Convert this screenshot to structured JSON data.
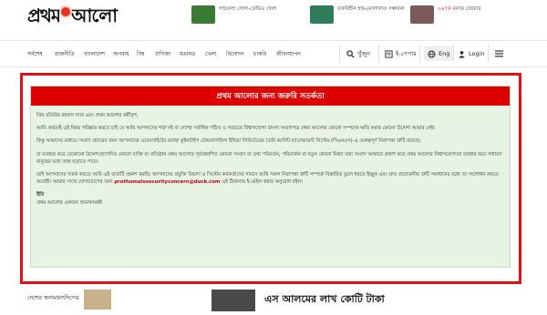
{
  "header": {
    "logo_text_before": "প্রথম",
    "logo_text_after": "আলো",
    "promos": [
      {
        "text": "গাছতলা লোল-ডেভিড খেলা",
        "highlight": "",
        "color": "#3a7a32"
      },
      {
        "text": "চাকরিহীন হার-মোলাকাত সম্ভাবনা",
        "highlight": "",
        "color": "#2f7d5a"
      },
      {
        "text": "বন্যার জোয়ার",
        "highlight": "০৬৭ফ",
        "color": "#7a5a5a"
      }
    ]
  },
  "nav": {
    "items": [
      "সর্বশেষ",
      "রাজনীতি",
      "বাংলাদেশ",
      "অপরাধ",
      "বিশ্ব",
      "বাণিজ্য",
      "মতামত",
      "খেলা",
      "বিনোদন",
      "চাকরি",
      "জীবনযাপন"
    ],
    "search_label": "খুঁজুন",
    "epaper_label": "ই-পেপার",
    "lang_label": "Eng",
    "login_label": "Login"
  },
  "alert": {
    "title": "প্রথম আলোর জন্য জরুরি সতর্কতা",
    "greeting": "প্রিয় মতিউর রহমান স্যার এবং প্রথম আলোর কর্মীবৃন্দ,",
    "p1": "আমি প্রথমেই এই বিষয় পরিষ্কার করতে চাই যে আমি আপনাদের শত্রু নই বা দেশের সর্বাধিক পঠিত ও সবচেয়ে বিশ্বাসযোগ্য বাংলা সংবাদপত্র প্রথম আলোর কোনো সম্পদের ক্ষতি করার কোনো উদ্দেশ্য আমার নেই।",
    "p2": "কিন্তু আমাদের মাধ্যমে সংবাদ প্রচারের জন্য আপনাদের ওয়েবসাইটের ব্যবস্থা কুইনটাইপ টেকনোলজিস ইন্ডিয়া লিমিটেডের তৈরি কন্টেন্ট ম্যানেজমেন্ট সিস্টেম (সিএমএস)-এ গুরুত্বপূর্ণ নিরাপত্তা ত্রুটি রয়েছে।",
    "p3": "যা ব্যবহার করে যেকোনো উদ্দেশ্যপ্রণোদিত কোনো ব্যক্তি বা প্রতিষ্ঠান প্রথম আলোর পূর্বপ্রকাশিত কোনো সংবাদ বা তথ্য পরিবর্তন, পরিমার্জন বা নতুন কোনো মিথ্যা তথ্য সংবাদ আকারে প্রকাশ করে প্রথম আলোর বিশ্বাসযোগ্যতা ব্যবহার করে সাধারণ মানুষের মধ্যে ভ্রান্ত ছড়াতে পারে।",
    "p4_before": "তাই আপনাদের সতর্ক করতে আমি এই বার্তাটি প্রকাশ করছি। আপনাদের প্রযুক্তি বিভাগ ও সিস্টেম কর্মকর্তাদের সামনে আমি সকল নিরাপত্তা ত্রুটি সম্পর্কে বিস্তারিত তুলে ধরতে ইচ্ছুক এবং দ্রুত প্রয়োজনীয় ত্রুটি সমাধানের মধ্যে তা সংশোধন করতে আগ্রহী। আমার সাথে যোগাযোগের জন্য ",
    "email": "prothomalosecurityconcern@duck.com",
    "p4_after": " এই ঠিকানায় ই-মেইল করার অনুরোধ রইল।",
    "sign_off": "ইতি",
    "signature": "প্রথম আলোর একজন শুভাকাঙ্ক্ষী"
  },
  "bottom": {
    "left_text": "দেশের স্বনামধন্যদিগের",
    "headline": "এস আলমের লাখ কোটি টাকা"
  },
  "colors": {
    "accent_red": "#dd0000",
    "panel_green": "#e7f3e3",
    "border_red": "#e0101a"
  }
}
